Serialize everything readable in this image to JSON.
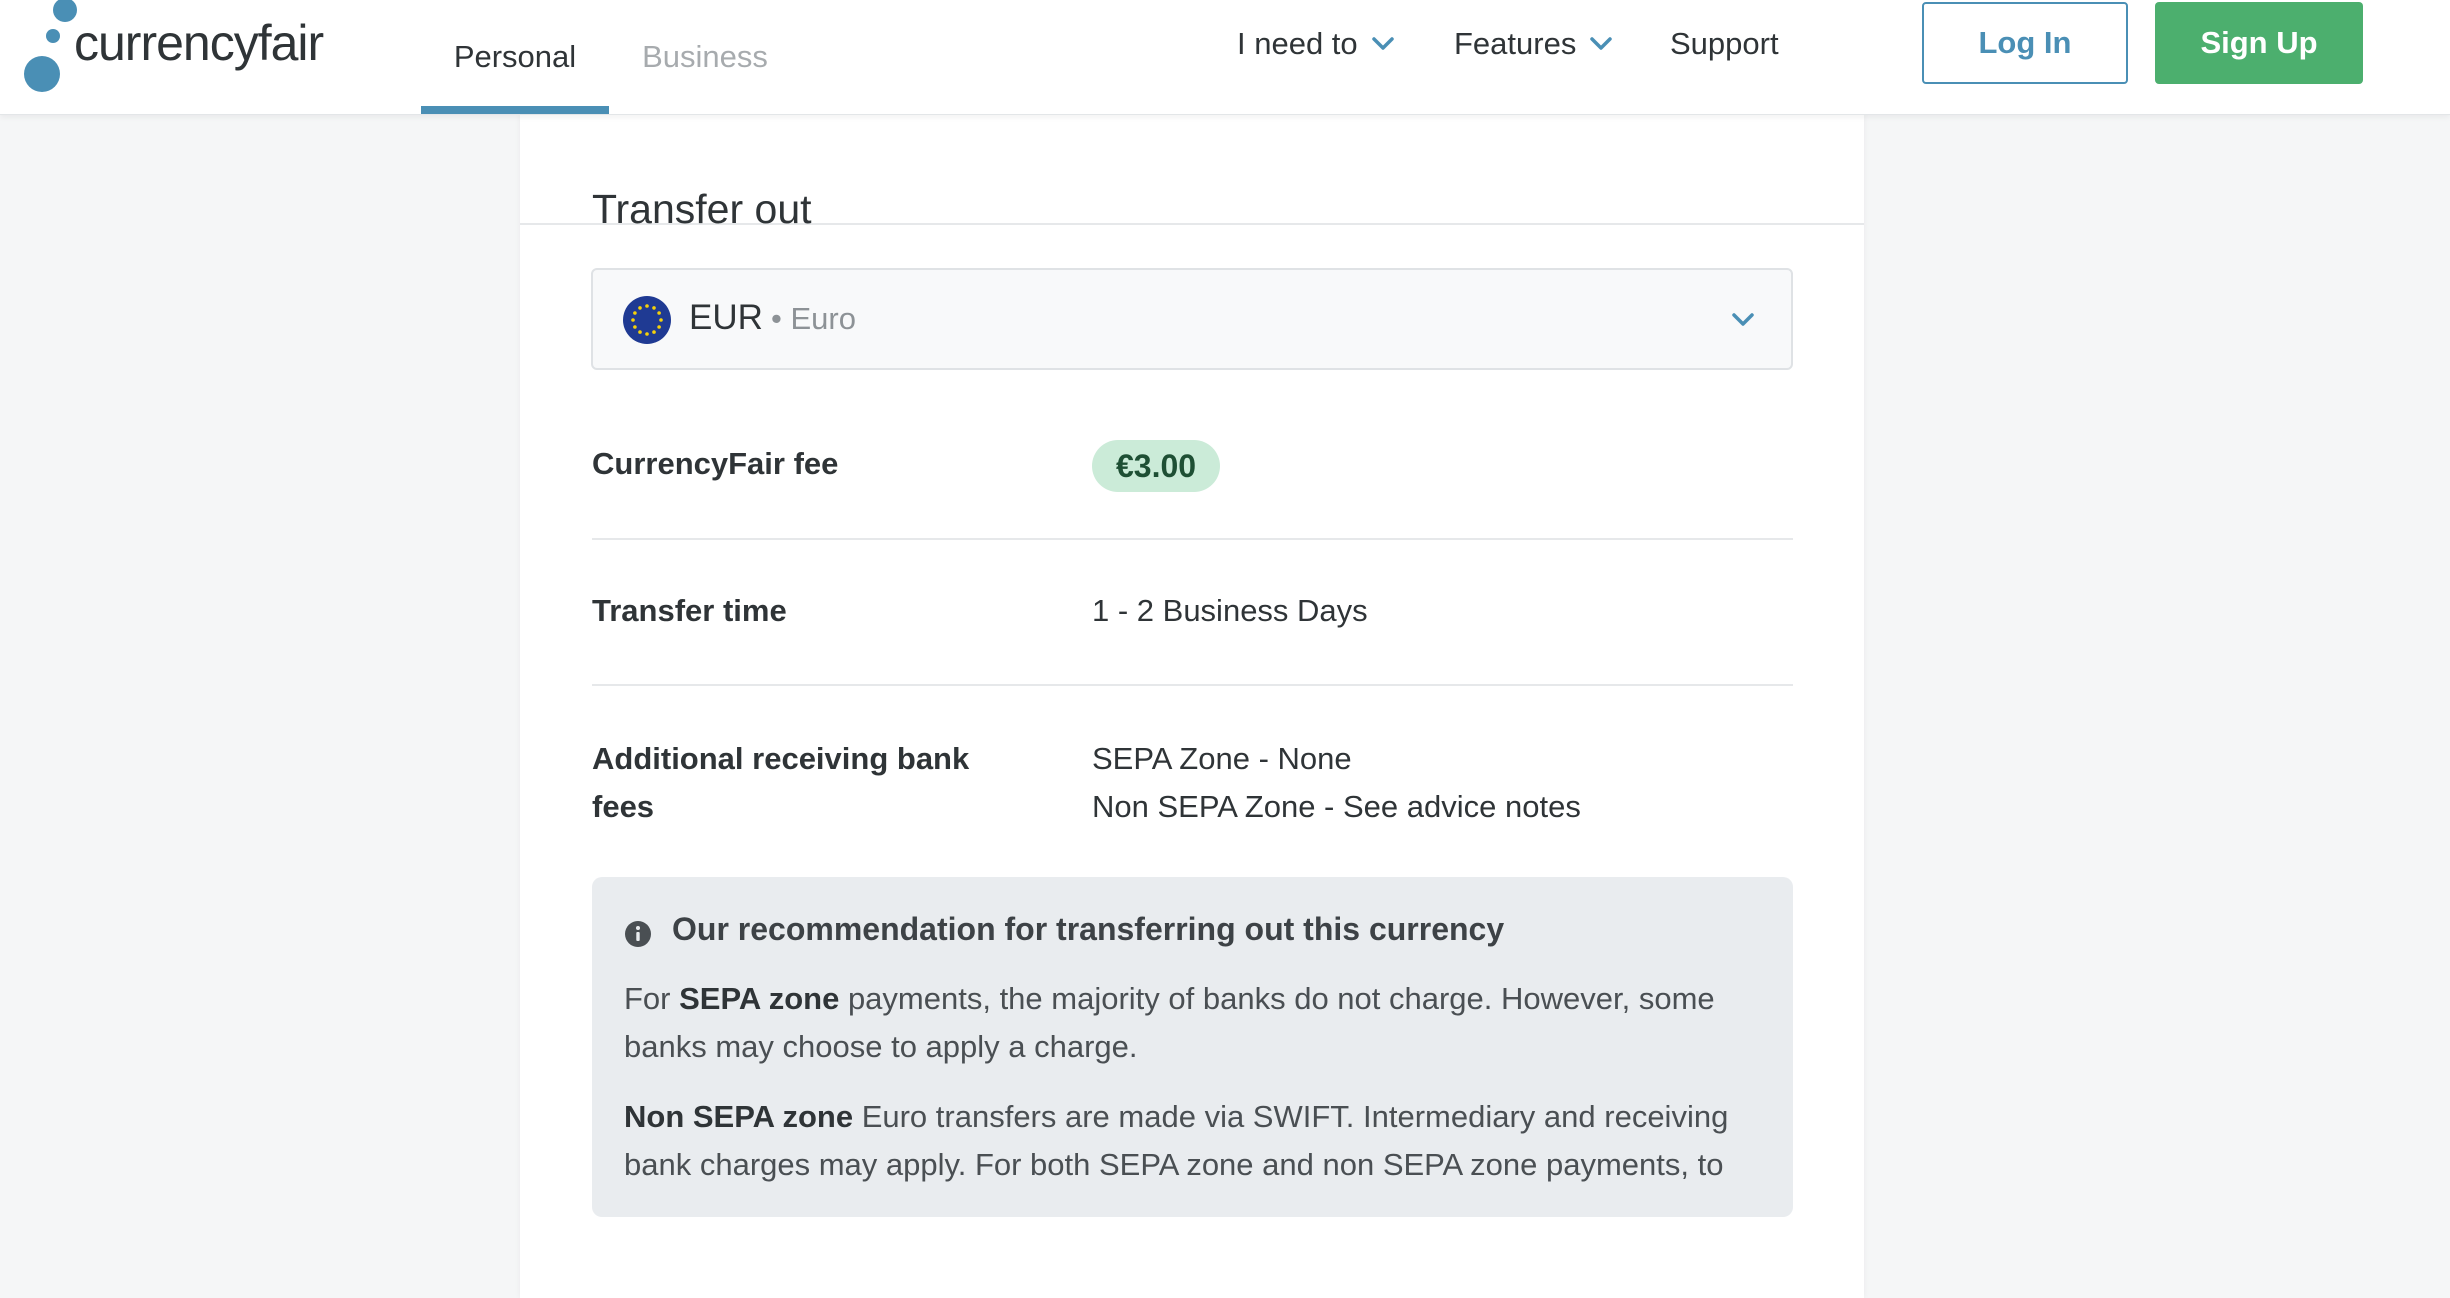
{
  "header": {
    "logo_text": "currencyfair",
    "tabs": [
      {
        "label": "Personal",
        "active": true
      },
      {
        "label": "Business",
        "active": false
      }
    ],
    "menus": [
      {
        "label": "I need to",
        "has_dropdown": true
      },
      {
        "label": "Features",
        "has_dropdown": true
      },
      {
        "label": "Support",
        "has_dropdown": false
      }
    ],
    "login_label": "Log In",
    "signup_label": "Sign Up"
  },
  "transfer_out": {
    "title": "Transfer out",
    "currency": {
      "code": "EUR",
      "name": "• Euro",
      "flag_icon": "eu-flag-icon"
    },
    "fee_label": "CurrencyFair fee",
    "fee_value": "€3.00",
    "time_label": "Transfer time",
    "time_value": "1 - 2 Business Days",
    "bank_fees_label": "Additional receiving bank fees",
    "bank_fees_values": [
      "SEPA Zone - None",
      "Non SEPA Zone - See advice notes"
    ]
  },
  "recommendation": {
    "title": "Our recommendation for transferring out this currency",
    "para1_prefix": "For ",
    "para1_bold": "SEPA zone",
    "para1_rest": " payments, the majority of banks do not charge. However, some banks may choose to apply a charge.",
    "para2_bold": "Non SEPA zone",
    "para2_rest": " Euro transfers are made via SWIFT. Intermediary and receiving bank charges may apply. For both SEPA zone and non SEPA zone payments, to"
  },
  "colors": {
    "brand_blue": "#4a8fb5",
    "signup_green": "#4caf6e",
    "fee_badge_bg": "#cbebd8",
    "page_bg": "#f5f6f7"
  }
}
